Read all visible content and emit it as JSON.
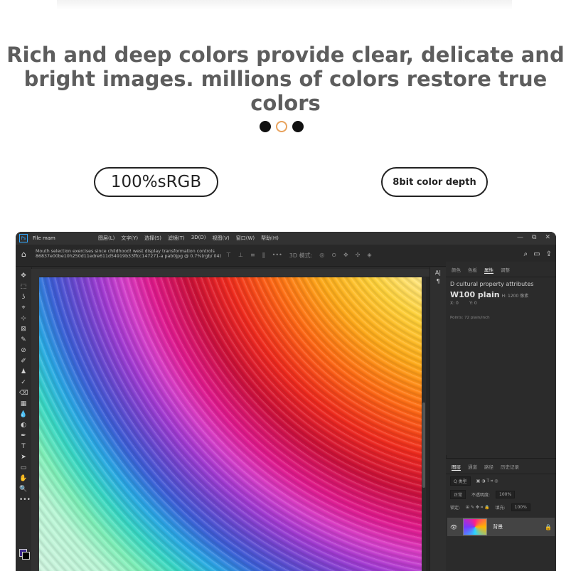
{
  "headline": {
    "line1": "Rich and deep colors provide clear, delicate and",
    "line2": "bright images. millions of colors restore true colors"
  },
  "carousel": {
    "dots": 3,
    "active_index": 1
  },
  "badges": {
    "srgb": "100%sRGB",
    "depth": "8bit color depth"
  },
  "app": {
    "file_title": "File mam",
    "menus": [
      "图层(L)",
      "文字(Y)",
      "选择(S)",
      "滤镜(T)",
      "3D(D)",
      "视图(V)",
      "窗口(W)",
      "帮助(H)"
    ],
    "window_controls": [
      "—",
      "⧉",
      "✕"
    ],
    "options_text": "Mouth selection exercises since childhood! west display transformation controls 86837e00be10h250d11edre611d54919b33ffcc147271-a pab0jpg @ 0.7%(rgb/ 04)",
    "options_icons": [
      "⊤",
      "⊥",
      "≡",
      "‖",
      "•••",
      "3D 模式:",
      "◎",
      "⊙",
      "✥",
      "✣",
      "◈"
    ],
    "properties": {
      "tabs": [
        "颜色",
        "色板",
        "属性",
        "调整"
      ],
      "active_tab": "属性",
      "section": "D cultural property attributes",
      "size_label": "W100 plain",
      "h_text": "H: 1200 像素",
      "x_text": "X: 0",
      "y_text": "Y: 0",
      "resolution": "Points: 72 plain/inch"
    },
    "layers": {
      "tabs": [
        "图层",
        "通道",
        "路径",
        "历史记录"
      ],
      "active_tab": "图层",
      "kind_filter": "Q 类型",
      "blend_mode": "正常",
      "opacity_label": "不透明度:",
      "opacity": "100%",
      "lock_label": "锁定:",
      "fill_label": "填充:",
      "fill": "100%",
      "layer_name": "背景"
    },
    "tools": [
      "✥",
      "⬚",
      "ʖ",
      "⌖",
      "⊹",
      "⊠",
      "✎",
      "⊘",
      "✐",
      "♟",
      "✓",
      "⌫",
      "▦",
      "💧",
      "◐",
      "✒",
      "T",
      "➤",
      "▭",
      "✋",
      "🔍",
      "•••"
    ]
  },
  "colors": {
    "accent_dot": "#e8a25c",
    "ps_blue": "#31a8ff"
  }
}
